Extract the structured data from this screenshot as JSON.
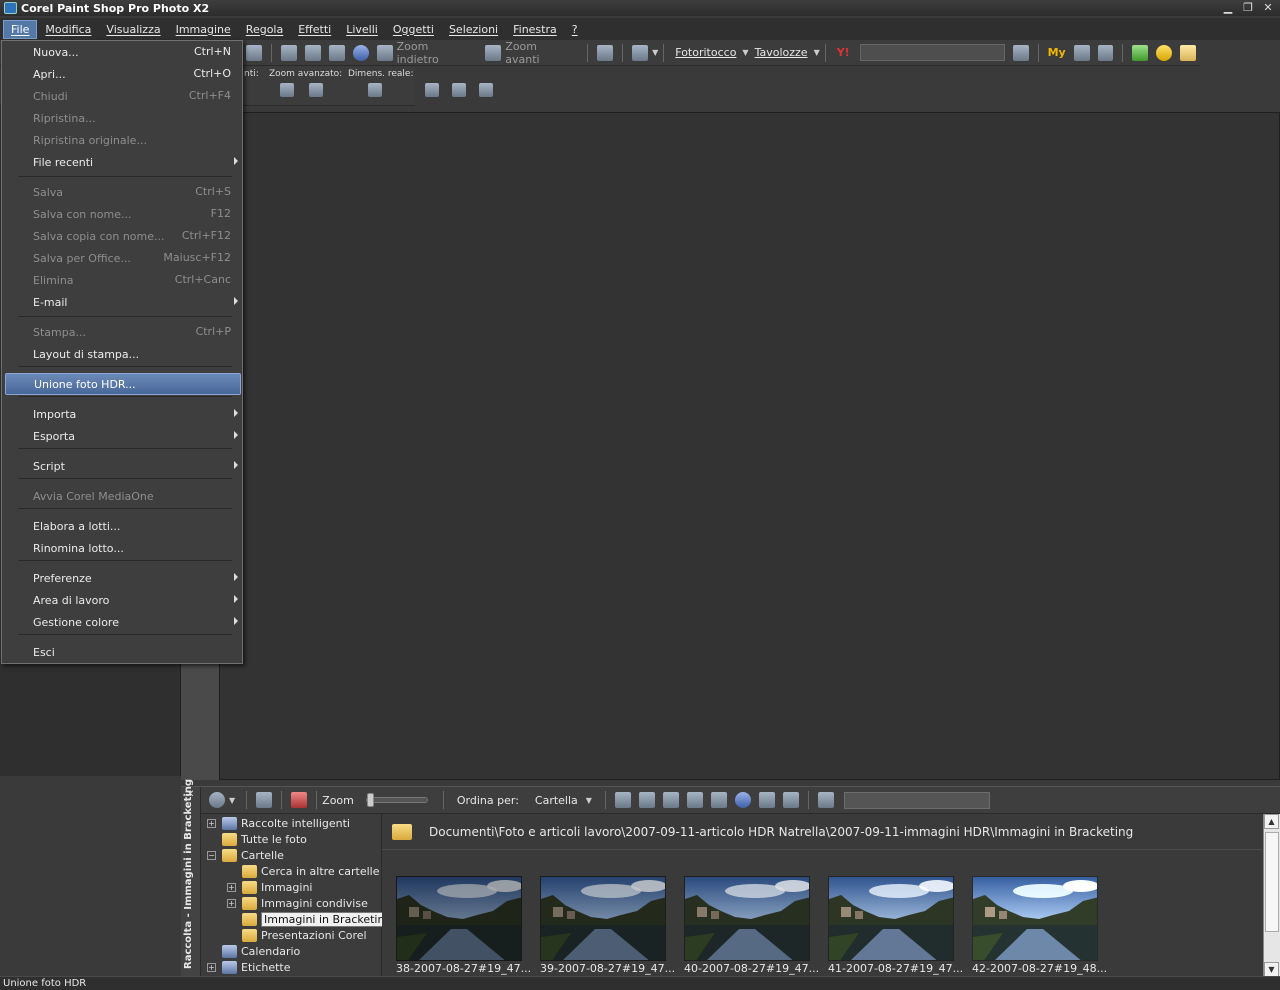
{
  "window": {
    "title": "Corel Paint Shop Pro Photo X2",
    "status": "Unione foto HDR"
  },
  "menubar": [
    "File",
    "Modifica",
    "Visualizza",
    "Immagine",
    "Regola",
    "Effetti",
    "Livelli",
    "Oggetti",
    "Selezioni",
    "Finestra",
    "?"
  ],
  "toolbar1": {
    "zoom_out": "Zoom indietro",
    "zoom_in": "Zoom avanti",
    "fotoritocco": "Fotoritocco",
    "tavolozze": "Tavolozze",
    "my_label": "My"
  },
  "toolbar2": {
    "partial_label": "nti:",
    "zoom_adv": "Zoom avanzato:",
    "dimens": "Dimens. reale:"
  },
  "file_menu": [
    {
      "label": "Nuova...",
      "shortcut": "Ctrl+N",
      "disabled": false
    },
    {
      "label": "Apri...",
      "shortcut": "Ctrl+O",
      "disabled": false
    },
    {
      "label": "Chiudi",
      "shortcut": "Ctrl+F4",
      "disabled": true
    },
    {
      "label": "Ripristina...",
      "shortcut": "",
      "disabled": true
    },
    {
      "label": "Ripristina originale...",
      "shortcut": "",
      "disabled": true
    },
    {
      "label": "File recenti",
      "shortcut": "",
      "disabled": false,
      "submenu": true
    },
    {
      "label": "Salva",
      "shortcut": "Ctrl+S",
      "disabled": true
    },
    {
      "label": "Salva con nome...",
      "shortcut": "F12",
      "disabled": true
    },
    {
      "label": "Salva copia con nome...",
      "shortcut": "Ctrl+F12",
      "disabled": true
    },
    {
      "label": "Salva per Office...",
      "shortcut": "Maiusc+F12",
      "disabled": true
    },
    {
      "label": "Elimina",
      "shortcut": "Ctrl+Canc",
      "disabled": true
    },
    {
      "label": "E-mail",
      "shortcut": "",
      "disabled": false,
      "submenu": true
    },
    {
      "label": "Stampa...",
      "shortcut": "Ctrl+P",
      "disabled": true
    },
    {
      "label": "Layout di stampa...",
      "shortcut": "",
      "disabled": false
    },
    {
      "label": "Unione foto HDR...",
      "shortcut": "",
      "disabled": false,
      "highlighted": true
    },
    {
      "label": "Importa",
      "shortcut": "",
      "disabled": false,
      "submenu": true
    },
    {
      "label": "Esporta",
      "shortcut": "",
      "disabled": false,
      "submenu": true
    },
    {
      "label": "Script",
      "shortcut": "",
      "disabled": false,
      "submenu": true
    },
    {
      "label": "Avvia Corel MediaOne",
      "shortcut": "",
      "disabled": true
    },
    {
      "label": "Elabora a lotti...",
      "shortcut": "",
      "disabled": false
    },
    {
      "label": "Rinomina lotto...",
      "shortcut": "",
      "disabled": false
    },
    {
      "label": "Preferenze",
      "shortcut": "",
      "disabled": false,
      "submenu": true
    },
    {
      "label": "Area di lavoro",
      "shortcut": "",
      "disabled": false,
      "submenu": true
    },
    {
      "label": "Gestione colore",
      "shortcut": "",
      "disabled": false,
      "submenu": true
    },
    {
      "label": "Esci",
      "shortcut": "",
      "disabled": false
    }
  ],
  "organizer": {
    "panel_title": "Raccolta - Immagini in Bracketing",
    "zoom_label": "Zoom",
    "zoom_value": 0,
    "sort_label": "Ordina per:",
    "sort_value": "Cartella",
    "path": "Documenti\\Foto e articoli lavoro\\2007-09-11-articolo HDR Natrella\\2007-09-11-immagini HDR\\Immagini in Bracketing",
    "tree": [
      {
        "label": "Raccolte intelligenti",
        "expander": "+",
        "icon": "blue"
      },
      {
        "label": "Tutte le foto",
        "expander": "",
        "icon": "folder"
      },
      {
        "label": "Cartelle",
        "expander": "−",
        "icon": "folder"
      },
      {
        "label": "Cerca in altre cartelle",
        "expander": "",
        "icon": "folder"
      },
      {
        "label": "Immagini",
        "expander": "+",
        "icon": "folder"
      },
      {
        "label": "Immagini condivise",
        "expander": "+",
        "icon": "folder"
      },
      {
        "label": "Immagini in Bracketing",
        "expander": "",
        "icon": "folder",
        "selected": true
      },
      {
        "label": "Presentazioni Corel",
        "expander": "",
        "icon": "folder"
      },
      {
        "label": "Calendario",
        "expander": "",
        "icon": "blue"
      },
      {
        "label": "Etichette",
        "expander": "+",
        "icon": "blue"
      }
    ],
    "thumbnails": [
      {
        "caption": "38-2007-08-27#19_47...",
        "brightness": 0.35
      },
      {
        "caption": "39-2007-08-27#19_47...",
        "brightness": 0.5
      },
      {
        "caption": "40-2007-08-27#19_47...",
        "brightness": 0.65
      },
      {
        "caption": "41-2007-08-27#19_47...",
        "brightness": 0.82
      },
      {
        "caption": "42-2007-08-27#19_48...",
        "brightness": 1.0
      }
    ]
  }
}
